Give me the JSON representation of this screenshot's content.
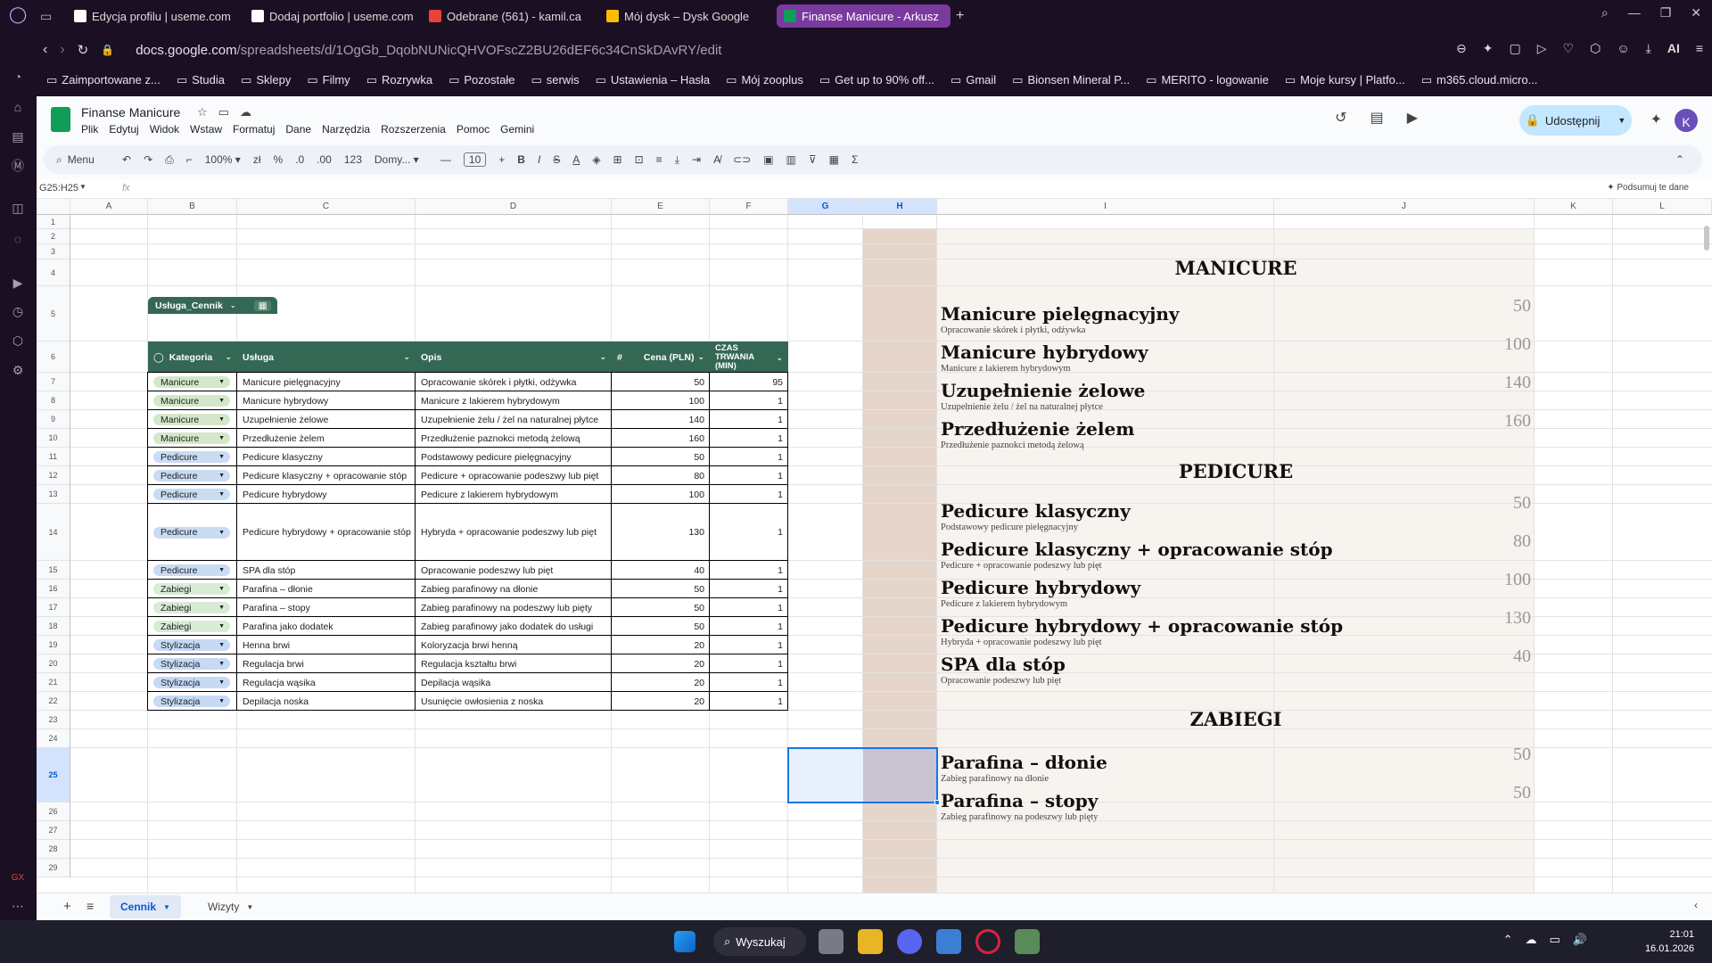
{
  "browser": {
    "tabs": [
      {
        "label": "Edycja profilu | useme.com",
        "color": "#ffffff"
      },
      {
        "label": "Dodaj portfolio | useme.com",
        "color": "#ffffff"
      },
      {
        "label": "Odebrane (561) - kamil.ca",
        "color": "#ea4335"
      },
      {
        "label": "Mój dysk – Dysk Google",
        "color": "#fbbc04"
      },
      {
        "label": "Finanse Manicure - Arkusz",
        "color": "#0f9d58"
      }
    ],
    "new_tab": "+",
    "url_host": "docs.google.com",
    "url_path": "/spreadsheets/d/1OgGb_DqobNUNicQHVOFscZ2BU26dEF6c34CnSkDAvRY/edit",
    "ai_label": "AI",
    "bookmarks": [
      "Zaimportowane z...",
      "Studia",
      "Sklepy",
      "Filmy",
      "Rozrywka",
      "Pozostałe",
      "serwis",
      "Ustawienia – Hasła",
      "Mój zooplus",
      "Get up to 90% off...",
      "Gmail",
      "Bionsen Mineral P...",
      "MERITO - logowanie",
      "Moje kursy | Platfo...",
      "m365.cloud.micro..."
    ]
  },
  "sheets": {
    "title": "Finanse Manicure",
    "menu": [
      "Plik",
      "Edytuj",
      "Widok",
      "Wstaw",
      "Formatuj",
      "Dane",
      "Narzędzia",
      "Rozszerzenia",
      "Pomoc",
      "Gemini"
    ],
    "share_label": "Udostępnij",
    "avatar_letter": "K",
    "toolbar": {
      "search": "Menu",
      "zoom": "100%",
      "currency": "zł",
      "percent": "%",
      "dec_minus": ".0",
      "dec_plus": ".00",
      "num": "123",
      "font": "Domy...",
      "font_size": "10",
      "bold": "B",
      "italic": "I",
      "strike": "S",
      "textcolor": "A",
      "sigma": "Σ"
    },
    "name_box": "G25:H25",
    "fx": "fx",
    "summarize": "Podsumuj te dane",
    "columns": [
      "A",
      "B",
      "C",
      "D",
      "E",
      "F",
      "G",
      "H",
      "I",
      "J",
      "K",
      "L"
    ],
    "rows": [
      "1",
      "2",
      "3",
      "4",
      "5",
      "6",
      "7",
      "8",
      "9",
      "10",
      "11",
      "12",
      "13",
      "14",
      "15",
      "16",
      "17",
      "18",
      "19",
      "20",
      "21",
      "22",
      "23",
      "24",
      "25",
      "26",
      "27",
      "28",
      "29"
    ],
    "table": {
      "name": "Usługa_Cennik",
      "headers": [
        "Kategoria",
        "Usługa",
        "Opis",
        "Cena (PLN)",
        "CZAS TRWANIA (MIN)"
      ],
      "rows": [
        {
          "cat": "Manicure",
          "svc": "Manicure pielęgnacyjny",
          "desc": "Opracowanie skórek i płytki, odżywka",
          "price": "50",
          "time": "95"
        },
        {
          "cat": "Manicure",
          "svc": "Manicure hybrydowy",
          "desc": "Manicure z lakierem hybrydowym",
          "price": "100",
          "time": "1"
        },
        {
          "cat": "Manicure",
          "svc": "Uzupełnienie żelowe",
          "desc": "Uzupełnienie żelu / żel na naturalnej płytce",
          "price": "140",
          "time": "1"
        },
        {
          "cat": "Manicure",
          "svc": "Przedłużenie żelem",
          "desc": "Przedłużenie paznokci metodą żelową",
          "price": "160",
          "time": "1"
        },
        {
          "cat": "Pedicure",
          "svc": "Pedicure klasyczny",
          "desc": "Podstawowy pedicure pielęgnacyjny",
          "price": "50",
          "time": "1"
        },
        {
          "cat": "Pedicure",
          "svc": "Pedicure klasyczny + opracowanie stóp",
          "desc": "Pedicure + opracowanie podeszwy lub pięt",
          "price": "80",
          "time": "1"
        },
        {
          "cat": "Pedicure",
          "svc": "Pedicure hybrydowy",
          "desc": "Pedicure z lakierem hybrydowym",
          "price": "100",
          "time": "1"
        },
        {
          "cat": "Pedicure",
          "svc": "Pedicure hybrydowy + opracowanie stóp",
          "desc": "Hybryda + opracowanie podeszwy lub pięt",
          "price": "130",
          "time": "1"
        },
        {
          "cat": "Pedicure",
          "svc": "SPA dla stóp",
          "desc": "Opracowanie podeszwy lub pięt",
          "price": "40",
          "time": "1"
        },
        {
          "cat": "Zabiegi",
          "svc": "Parafina – dłonie",
          "desc": "Zabieg parafinowy na dłonie",
          "price": "50",
          "time": "1"
        },
        {
          "cat": "Zabiegi",
          "svc": "Parafina – stopy",
          "desc": "Zabieg parafinowy na podeszwy lub pięty",
          "price": "50",
          "time": "1"
        },
        {
          "cat": "Zabiegi",
          "svc": "Parafina jako dodatek",
          "desc": "Zabieg parafinowy jako dodatek do usługi",
          "price": "50",
          "time": "1"
        },
        {
          "cat": "Stylizacja",
          "svc": "Henna brwi",
          "desc": "Koloryzacja brwi henną",
          "price": "20",
          "time": "1"
        },
        {
          "cat": "Stylizacja",
          "svc": "Regulacja brwi",
          "desc": "Regulacja kształtu brwi",
          "price": "20",
          "time": "1"
        },
        {
          "cat": "Stylizacja",
          "svc": "Regulacja wąsika",
          "desc": "Depilacja wąsika",
          "price": "20",
          "time": "1"
        },
        {
          "cat": "Stylizacja",
          "svc": "Depilacja noska",
          "desc": "Usunięcie owłosienia z noska",
          "price": "20",
          "time": "1"
        }
      ],
      "chip_colors": {
        "Manicure": "#d4e8c9",
        "Pedicure": "#c9dcf2",
        "Zabiegi": "#d8ecd5",
        "Stylizacja": "#c6daf5"
      }
    },
    "price_list": [
      {
        "type": "section",
        "label": "MANICURE"
      },
      {
        "type": "item",
        "name": "Manicure pielęgnacyjny",
        "desc": "Opracowanie skórek i płytki, odżywka",
        "price": "50"
      },
      {
        "type": "item",
        "name": "Manicure hybrydowy",
        "desc": "Manicure z lakierem hybrydowym",
        "price": "100"
      },
      {
        "type": "item",
        "name": "Uzupełnienie żelowe",
        "desc": "Uzupełnienie żelu / żel na naturalnej płytce",
        "price": "140"
      },
      {
        "type": "item",
        "name": "Przedłużenie żelem",
        "desc": "Przedłużenie paznokci metodą żelową",
        "price": "160"
      },
      {
        "type": "section",
        "label": "PEDICURE"
      },
      {
        "type": "item",
        "name": "Pedicure klasyczny",
        "desc": "Podstawowy pedicure pielęgnacyjny",
        "price": "50"
      },
      {
        "type": "item",
        "name": "Pedicure klasyczny + opracowanie stóp",
        "desc": "Pedicure + opracowanie podeszwy lub pięt",
        "price": "80"
      },
      {
        "type": "item",
        "name": "Pedicure hybrydowy",
        "desc": "Pedicure z lakierem hybrydowym",
        "price": "100"
      },
      {
        "type": "item",
        "name": "Pedicure hybrydowy + opracowanie stóp",
        "desc": "Hybryda + opracowanie podeszwy lub pięt",
        "price": "130"
      },
      {
        "type": "item",
        "name": "SPA dla stóp",
        "desc": "Opracowanie podeszwy lub pięt",
        "price": "40"
      },
      {
        "type": "section",
        "label": "ZABIEGI"
      },
      {
        "type": "item",
        "name": "Parafina – dłonie",
        "desc": "Zabieg parafinowy na dłonie",
        "price": "50"
      },
      {
        "type": "item",
        "name": "Parafina – stopy",
        "desc": "Zabieg parafinowy na podeszwy lub pięty",
        "price": "50"
      }
    ],
    "sheet_tabs": [
      "Cennik",
      "Wizyty"
    ],
    "add_sheet": "+"
  },
  "taskbar": {
    "search": "Wyszukaj",
    "time": "21:01",
    "date": "16.01.2026"
  }
}
